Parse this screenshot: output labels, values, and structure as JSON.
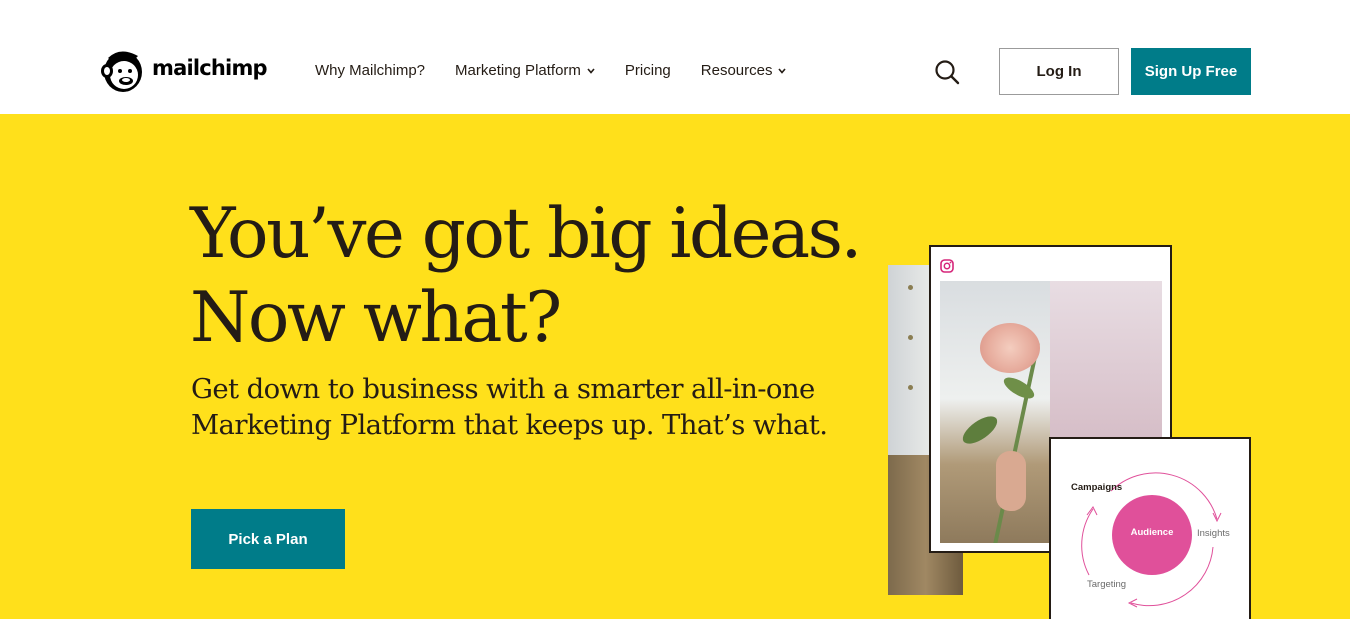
{
  "brand": {
    "name": "mailchimp",
    "accent": "#007c89",
    "hero_bg": "#ffe01b",
    "text_color": "#241c15",
    "pink": "#e0509a"
  },
  "nav": {
    "items": [
      {
        "label": "Why Mailchimp?",
        "has_dropdown": false
      },
      {
        "label": "Marketing Platform",
        "has_dropdown": true
      },
      {
        "label": "Pricing",
        "has_dropdown": false
      },
      {
        "label": "Resources",
        "has_dropdown": true
      }
    ],
    "search_icon": "search-icon",
    "login_label": "Log In",
    "signup_label": "Sign Up Free"
  },
  "hero": {
    "headline": "You’ve got big ideas. Now what?",
    "subheadline": "Get down to business with a smarter all-in-one Marketing Platform that keeps up. That’s what.",
    "cta_label": "Pick a Plan"
  },
  "illustration": {
    "instagram_icon": "instagram-icon",
    "cycle": {
      "center": "Audience",
      "campaigns": "Campaigns",
      "insights": "Insights",
      "targeting": "Targeting"
    }
  }
}
